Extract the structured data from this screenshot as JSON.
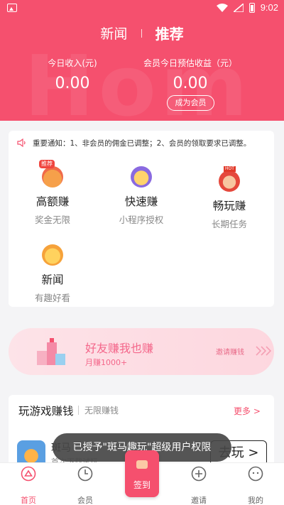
{
  "status_bar": {
    "time": "9:02"
  },
  "header": {
    "tabs": [
      {
        "label": "新闻"
      },
      {
        "label": "推荐"
      }
    ],
    "watermark": "Hom",
    "today_income_label": "今日收入(元)",
    "today_income_value": "0.00",
    "member_estimate_label": "会员今日预估收益（元）",
    "member_estimate_value": "0.00",
    "become_member_label": "成为会员",
    "colors": {
      "brand": "#f5506e"
    }
  },
  "notice": {
    "text": "重要通知：1、非会员的佣金已调整；2、会员的领取要求已调整。"
  },
  "features": [
    {
      "title": "高额赚",
      "subtitle": "奖金无限",
      "badge": "推荐",
      "icon": "treasure-bag-icon"
    },
    {
      "title": "快速赚",
      "subtitle": "小程序授权",
      "icon": "treasure-chest-icon"
    },
    {
      "title": "畅玩赚",
      "subtitle": "长期任务",
      "badge": "HOT",
      "icon": "fortune-god-icon"
    },
    {
      "title": "新闻",
      "subtitle": "有趣好看",
      "icon": "gift-box-icon"
    }
  ],
  "banner": {
    "title": "好友赚我也赚",
    "subtitle": "月赚1000+",
    "action": "邀请赚钱"
  },
  "games": {
    "title": "玩游戏赚钱",
    "subtitle": "无限赚钱",
    "more": "更多 >",
    "items": [
      {
        "name": "斑马",
        "desc": "首次下载试玩",
        "button": "去玩 >"
      }
    ]
  },
  "toast": {
    "text": "已授予\"斑马趣玩\"超级用户权限"
  },
  "tabbar": {
    "items": [
      {
        "label": "首页",
        "icon": "home-icon"
      },
      {
        "label": "会员",
        "icon": "clock-icon"
      },
      {
        "label": "签到",
        "icon": "signin-icon"
      },
      {
        "label": "邀请",
        "icon": "plus-circle-icon"
      },
      {
        "label": "我的",
        "icon": "face-icon"
      }
    ]
  }
}
